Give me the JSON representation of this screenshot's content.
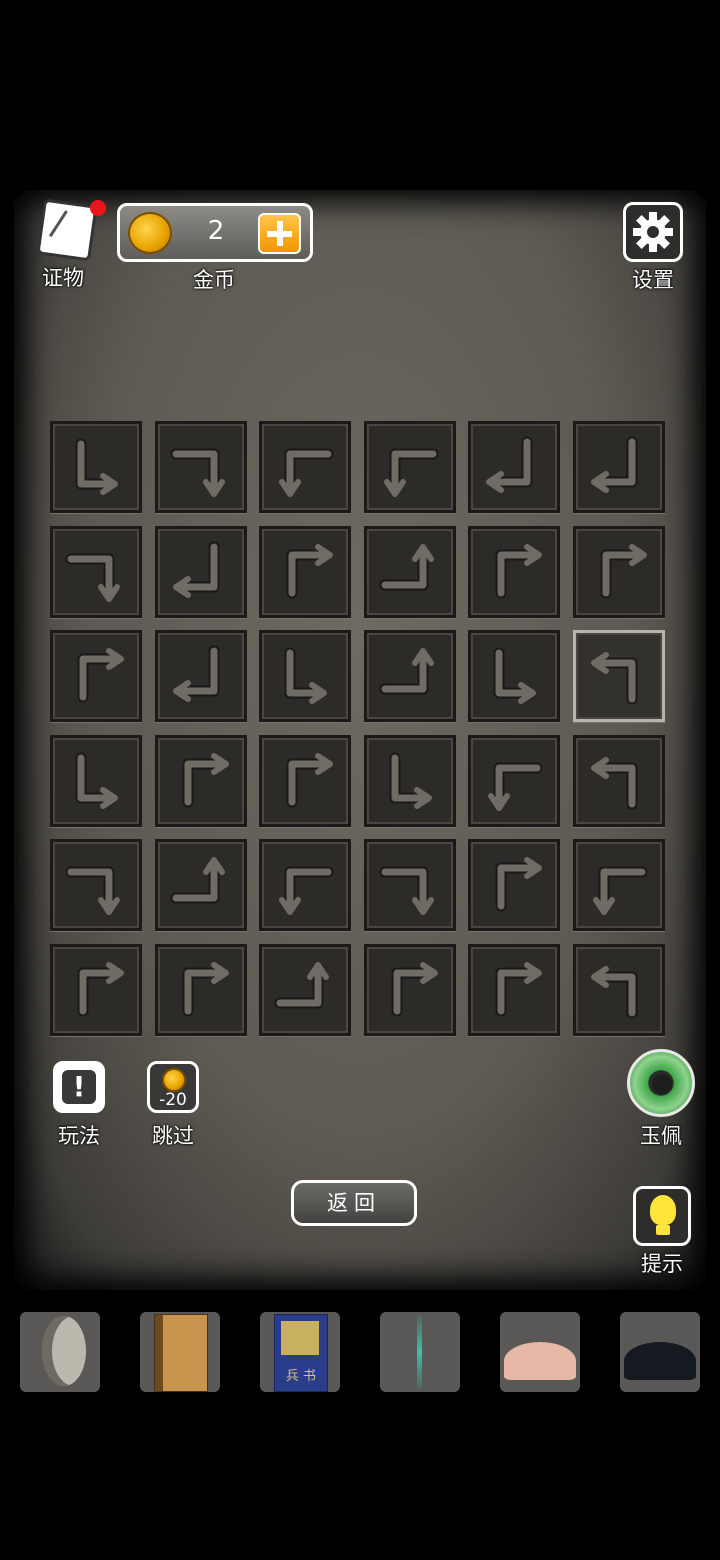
{
  "top": {
    "evidence_label": "证物",
    "coins_value": "2",
    "coins_label": "金币",
    "settings_label": "设置"
  },
  "actions": {
    "rules_label": "玩法",
    "skip_label": "跳过",
    "skip_cost": "-20",
    "jade_label": "玉佩",
    "hint_label": "提示",
    "back_label": "返回"
  },
  "puzzle": {
    "rows": 6,
    "cols": 6,
    "selected": {
      "row": 2,
      "col": 5
    },
    "tiles": [
      [
        "down-right",
        "right-down",
        "left-down",
        "left-down",
        "down-left",
        "down-left"
      ],
      [
        "right-down",
        "down-left",
        "up-right",
        "right-up",
        "up-right",
        "up-right"
      ],
      [
        "up-right",
        "down-left",
        "down-right",
        "right-up",
        "down-right",
        "up-left"
      ],
      [
        "down-right",
        "up-right",
        "up-right",
        "down-right",
        "left-down",
        "up-left"
      ],
      [
        "right-down",
        "right-up",
        "left-down",
        "right-down",
        "up-right",
        "left-down"
      ],
      [
        "up-right",
        "up-right",
        "right-up",
        "up-right",
        "up-right",
        "up-left"
      ]
    ]
  },
  "inventory": [
    "crescent-stone",
    "old-book",
    "bingshu-book",
    "green-sword",
    "pink-powder",
    "black-powder"
  ],
  "inventory_book_title": "兵 书",
  "colors": {
    "accent": "#f29600",
    "notify": "#e8161b",
    "jade": "#3fa64a"
  }
}
